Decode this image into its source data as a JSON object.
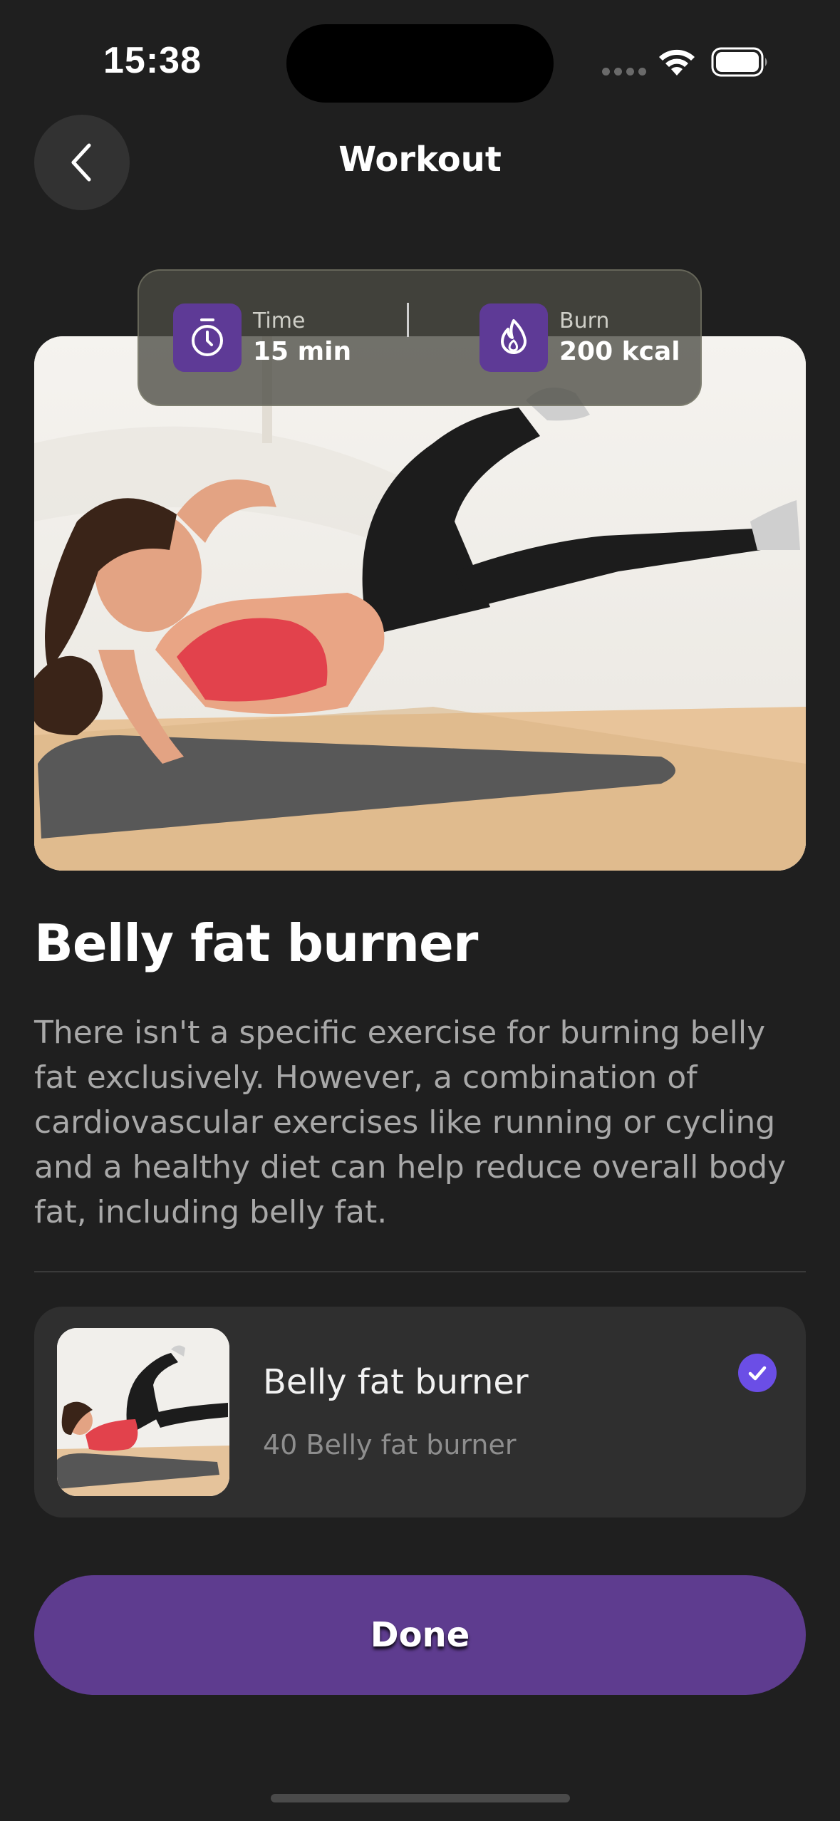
{
  "status_bar": {
    "time": "15:38"
  },
  "header": {
    "title": "Workout"
  },
  "stats": {
    "time": {
      "label": "Time",
      "value": "15 min",
      "icon": "timer-icon"
    },
    "burn": {
      "label": "Burn",
      "value": "200 kcal",
      "icon": "flame-icon"
    }
  },
  "workout": {
    "title": "Belly fat burner",
    "description": "There isn't a specific exercise for burning belly fat exclusively. However, a combination of cardiovascular exercises like running or cycling and a healthy diet can help reduce overall body fat, including belly fat."
  },
  "exercise": {
    "name": "Belly fat burner",
    "subtitle": "40 Belly fat burner",
    "completed": true
  },
  "actions": {
    "done_label": "Done"
  },
  "colors": {
    "background": "#1f1f1f",
    "accent": "#5e3c8f",
    "check": "#6b4ee6",
    "card": "#2f2f2f"
  }
}
